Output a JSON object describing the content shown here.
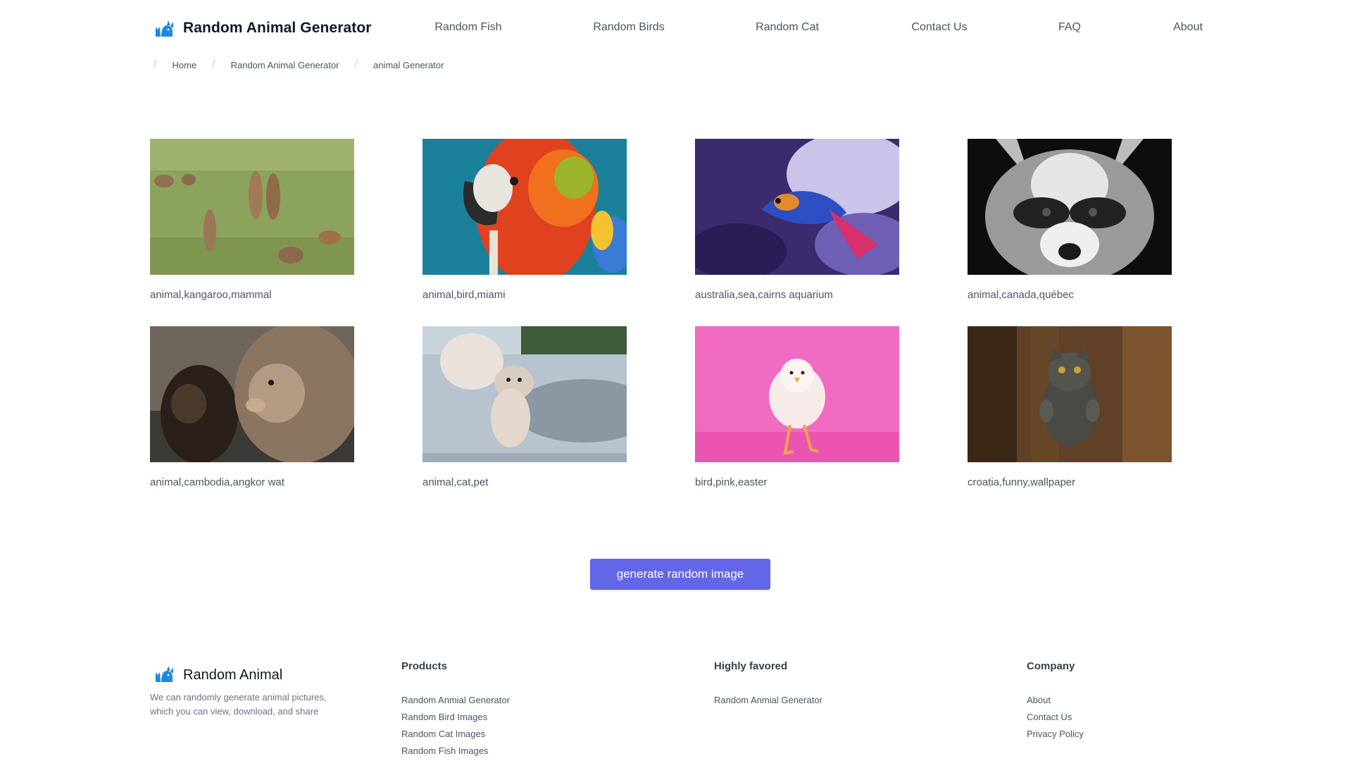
{
  "header": {
    "brand": "Random Animal Generator",
    "nav": [
      "Random Fish",
      "Random Birds",
      "Random Cat",
      "Contact Us",
      "FAQ",
      "About"
    ]
  },
  "breadcrumb": [
    "Home",
    "Random Animal Generator",
    "animal Generator"
  ],
  "gallery": [
    {
      "caption": "animal,kangaroo,mammal",
      "icon": "kangaroo-photo"
    },
    {
      "caption": "animal,bird,miami",
      "icon": "parrot-photo"
    },
    {
      "caption": "australia,sea,cairns aquarium",
      "icon": "mandarin-fish-photo"
    },
    {
      "caption": "animal,canada,québec",
      "icon": "raccoon-photo"
    },
    {
      "caption": "animal,cambodia,angkor wat",
      "icon": "monkeys-photo"
    },
    {
      "caption": "animal,cat,pet",
      "icon": "kitten-on-couch-photo"
    },
    {
      "caption": "bird,pink,easter",
      "icon": "chick-photo"
    },
    {
      "caption": "croatia,funny,wallpaper",
      "icon": "standing-cat-photo"
    }
  ],
  "action": {
    "generate_label": "generate random image",
    "color": "#6466e9"
  },
  "footer": {
    "brand": "Random Animal",
    "description": "We can randomly generate animal pictures, which you can view, download, and share",
    "columns": [
      {
        "title": "Products",
        "links": [
          "Random Anmial Generator",
          "Random Bird Images",
          "Random Cat Images",
          "Random Fish Images"
        ]
      },
      {
        "title": "Highly favored",
        "links": [
          "Random Anmial Generator"
        ]
      },
      {
        "title": "Company",
        "links": [
          "About",
          "Contact Us",
          "Privacy Policy"
        ]
      }
    ]
  }
}
